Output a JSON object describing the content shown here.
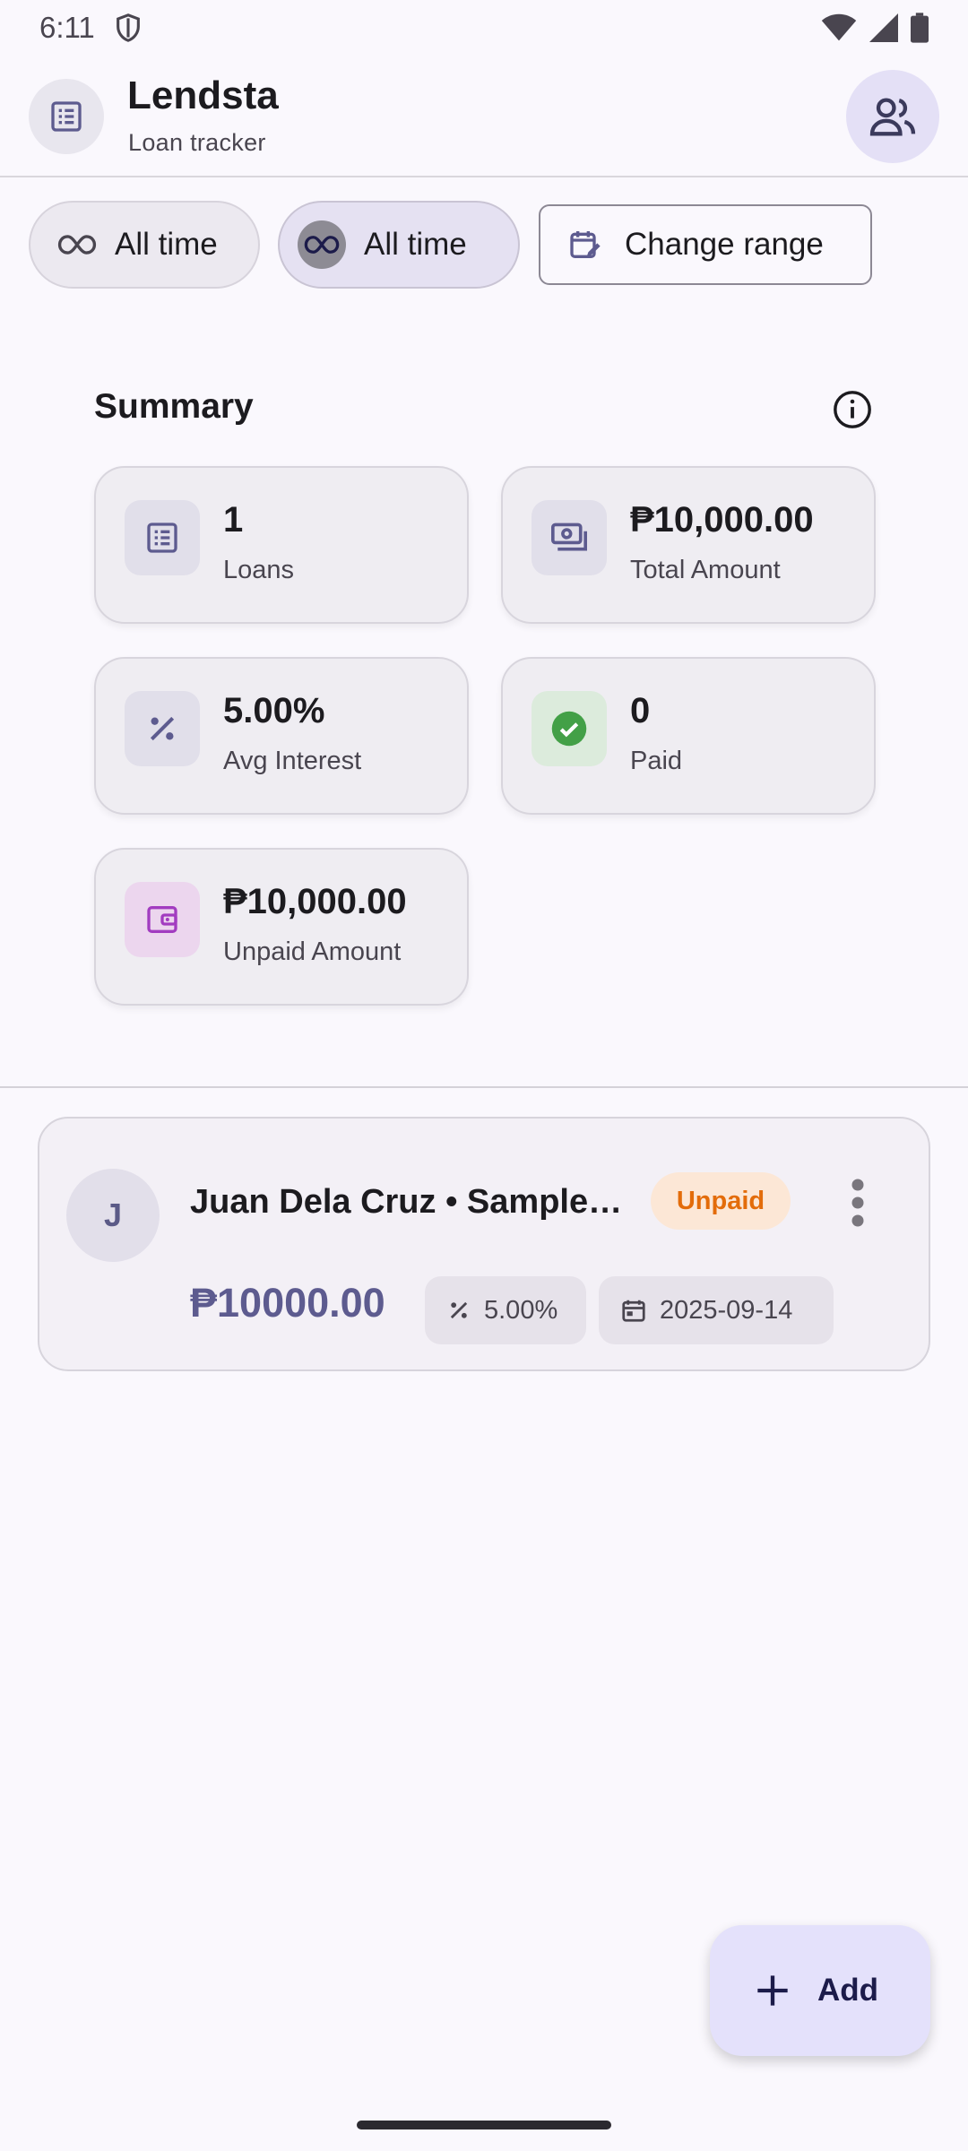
{
  "status_bar": {
    "time": "6:11"
  },
  "header": {
    "title": "Lendsta",
    "subtitle": "Loan tracker"
  },
  "filters": {
    "chip1_label": "All time",
    "chip2_label": "All time",
    "range_button_label": "Change range"
  },
  "summary": {
    "title": "Summary",
    "cards": [
      {
        "value": "1",
        "label": "Loans",
        "icon": "list-icon"
      },
      {
        "value": "₱10,000.00",
        "label": "Total Amount",
        "icon": "cash-icon"
      },
      {
        "value": "5.00%",
        "label": "Avg Interest",
        "icon": "percent-icon"
      },
      {
        "value": "0",
        "label": "Paid",
        "icon": "check-circle-icon"
      },
      {
        "value": "₱10,000.00",
        "label": "Unpaid Amount",
        "icon": "wallet-icon"
      }
    ]
  },
  "loans": [
    {
      "avatar_initial": "J",
      "name": "Juan Dela Cruz • Sample Loan",
      "status": "Unpaid",
      "amount": "₱10000.00",
      "rate": "5.00%",
      "date": "2025-09-14"
    }
  ],
  "fab": {
    "label": "Add"
  },
  "colors": {
    "accent": "#5d5b8f",
    "unpaid": "#e36c0a",
    "paid": "#43a047",
    "unpaid_icon": "#a23cc0"
  }
}
